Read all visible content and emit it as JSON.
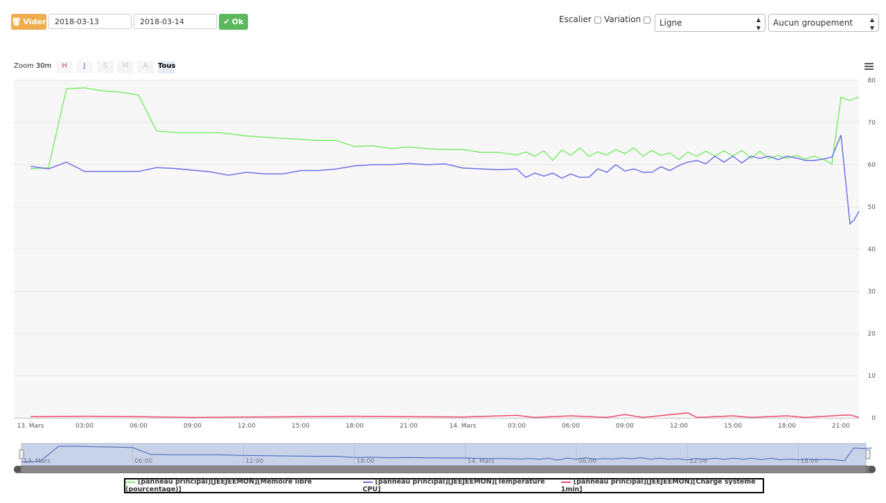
{
  "toolbar": {
    "clear_label": "Vider",
    "clear_icon": "trash-icon",
    "start_date": "2018-03-13",
    "end_date": "2018-03-14",
    "ok_label": "Ok",
    "ok_icon": "check-icon",
    "stairs_label": "Escalier",
    "stairs_checked": false,
    "variation_label": "Variation",
    "variation_checked": false,
    "chart_type_value": "Ligne",
    "grouping_value": "Aucun groupement"
  },
  "zoom": {
    "label": "Zoom",
    "buttons": [
      "30m",
      "H",
      "J",
      "S",
      "M",
      "A",
      "Tous"
    ],
    "active": "Tous"
  },
  "colors": {
    "orange": "#f0ad4e",
    "green_btn": "#5cb85c",
    "memory": "#7cec6a",
    "temperature": "#6f6fe8",
    "load": "#f0476a"
  },
  "chart_data": {
    "type": "line",
    "ylim": [
      0,
      80
    ],
    "yticks": [
      0,
      10,
      20,
      30,
      40,
      50,
      60,
      70,
      80
    ],
    "xrange": [
      "2018-03-13 00:00",
      "2018-03-14 22:00"
    ],
    "xtick_labels": [
      "13. Mars",
      "03:00",
      "06:00",
      "09:00",
      "12:00",
      "15:00",
      "18:00",
      "21:00",
      "14. Mars",
      "03:00",
      "06:00",
      "09:00",
      "12:00",
      "15:00",
      "18:00",
      "21:00"
    ],
    "navigator_labels": [
      "13. Mars",
      "06:00",
      "12:00",
      "18:00",
      "14. Mars",
      "06:00",
      "12:00",
      "18:00"
    ],
    "legend_placement": "bottom",
    "grid": true,
    "series": [
      {
        "name": "[panneau principal][JEEJEEMON][Mémoire libre (pourcentage)]",
        "color": "#7cec6a",
        "points": [
          [
            "2018-03-13 00:00",
            59
          ],
          [
            "2018-03-13 01:00",
            59.3
          ],
          [
            "2018-03-13 02:00",
            78
          ],
          [
            "2018-03-13 03:00",
            78.2
          ],
          [
            "2018-03-13 04:00",
            77.5
          ],
          [
            "2018-03-13 05:00",
            77.2
          ],
          [
            "2018-03-13 06:00",
            76.5
          ],
          [
            "2018-03-13 07:00",
            68
          ],
          [
            "2018-03-13 08:00",
            67.6
          ],
          [
            "2018-03-13 10:30",
            67.6
          ],
          [
            "2018-03-13 12:00",
            66.8
          ],
          [
            "2018-03-13 13:00",
            66.5
          ],
          [
            "2018-03-13 15:00",
            66
          ],
          [
            "2018-03-13 16:00",
            65.7
          ],
          [
            "2018-03-13 17:00",
            65.7
          ],
          [
            "2018-03-13 18:00",
            64.3
          ],
          [
            "2018-03-13 19:00",
            64.5
          ],
          [
            "2018-03-13 20:00",
            63.8
          ],
          [
            "2018-03-13 21:00",
            64.2
          ],
          [
            "2018-03-13 22:00",
            63.8
          ],
          [
            "2018-03-13 23:00",
            63.6
          ],
          [
            "2018-03-14 00:00",
            63.6
          ],
          [
            "2018-03-14 01:00",
            62.9
          ],
          [
            "2018-03-14 02:00",
            62.9
          ],
          [
            "2018-03-14 03:00",
            62.3
          ],
          [
            "2018-03-14 03:30",
            63
          ],
          [
            "2018-03-14 04:00",
            62
          ],
          [
            "2018-03-14 04:30",
            63.3
          ],
          [
            "2018-03-14 05:00",
            61
          ],
          [
            "2018-03-14 05:30",
            63.5
          ],
          [
            "2018-03-14 06:00",
            62.2
          ],
          [
            "2018-03-14 06:30",
            64
          ],
          [
            "2018-03-14 07:00",
            62
          ],
          [
            "2018-03-14 07:30",
            63
          ],
          [
            "2018-03-14 08:00",
            62.3
          ],
          [
            "2018-03-14 08:30",
            63.6
          ],
          [
            "2018-03-14 09:00",
            62.6
          ],
          [
            "2018-03-14 09:30",
            64
          ],
          [
            "2018-03-14 10:00",
            62
          ],
          [
            "2018-03-14 10:30",
            63.4
          ],
          [
            "2018-03-14 11:00",
            62.2
          ],
          [
            "2018-03-14 11:30",
            62.8
          ],
          [
            "2018-03-14 12:00",
            61.2
          ],
          [
            "2018-03-14 12:30",
            63
          ],
          [
            "2018-03-14 13:00",
            62
          ],
          [
            "2018-03-14 13:30",
            63.2
          ],
          [
            "2018-03-14 14:00",
            62
          ],
          [
            "2018-03-14 14:30",
            63.3
          ],
          [
            "2018-03-14 15:00",
            62
          ],
          [
            "2018-03-14 15:30",
            63.4
          ],
          [
            "2018-03-14 16:00",
            61.5
          ],
          [
            "2018-03-14 16:30",
            63.2
          ],
          [
            "2018-03-14 17:00",
            61.5
          ],
          [
            "2018-03-14 17:30",
            62.2
          ],
          [
            "2018-03-14 18:00",
            61.5
          ],
          [
            "2018-03-14 18:30",
            62.2
          ],
          [
            "2018-03-14 19:00",
            61.3
          ],
          [
            "2018-03-14 19:30",
            62
          ],
          [
            "2018-03-14 20:00",
            61.3
          ],
          [
            "2018-03-14 20:30",
            60.2
          ],
          [
            "2018-03-14 21:00",
            76
          ],
          [
            "2018-03-14 21:30",
            75.2
          ],
          [
            "2018-03-14 22:00",
            76
          ]
        ]
      },
      {
        "name": "[panneau principal][JEEJEEMON][Température CPU]",
        "color": "#6f6fe8",
        "points": [
          [
            "2018-03-13 00:00",
            59.6
          ],
          [
            "2018-03-13 01:00",
            59
          ],
          [
            "2018-03-13 02:00",
            60.6
          ],
          [
            "2018-03-13 03:00",
            58.4
          ],
          [
            "2018-03-13 06:00",
            58.4
          ],
          [
            "2018-03-13 07:00",
            59.3
          ],
          [
            "2018-03-13 08:00",
            59.1
          ],
          [
            "2018-03-13 10:00",
            58.3
          ],
          [
            "2018-03-13 11:00",
            57.5
          ],
          [
            "2018-03-13 12:00",
            58.2
          ],
          [
            "2018-03-13 13:00",
            57.8
          ],
          [
            "2018-03-13 14:00",
            57.8
          ],
          [
            "2018-03-13 15:00",
            58.6
          ],
          [
            "2018-03-13 16:00",
            58.6
          ],
          [
            "2018-03-13 17:00",
            59
          ],
          [
            "2018-03-13 18:00",
            59.7
          ],
          [
            "2018-03-13 19:00",
            60
          ],
          [
            "2018-03-13 20:00",
            60
          ],
          [
            "2018-03-13 21:00",
            60.3
          ],
          [
            "2018-03-13 22:00",
            60
          ],
          [
            "2018-03-13 23:00",
            60.2
          ],
          [
            "2018-03-14 00:00",
            59.2
          ],
          [
            "2018-03-14 02:00",
            58.8
          ],
          [
            "2018-03-14 03:00",
            59
          ],
          [
            "2018-03-14 03:30",
            57
          ],
          [
            "2018-03-14 04:00",
            58
          ],
          [
            "2018-03-14 04:30",
            57.3
          ],
          [
            "2018-03-14 05:00",
            58
          ],
          [
            "2018-03-14 05:30",
            56.8
          ],
          [
            "2018-03-14 06:00",
            57.8
          ],
          [
            "2018-03-14 06:30",
            57
          ],
          [
            "2018-03-14 07:00",
            57
          ],
          [
            "2018-03-14 07:30",
            59
          ],
          [
            "2018-03-14 08:00",
            58.2
          ],
          [
            "2018-03-14 08:30",
            60
          ],
          [
            "2018-03-14 09:00",
            58.5
          ],
          [
            "2018-03-14 09:30",
            59
          ],
          [
            "2018-03-14 10:00",
            58.2
          ],
          [
            "2018-03-14 10:30",
            58.2
          ],
          [
            "2018-03-14 11:00",
            59.5
          ],
          [
            "2018-03-14 11:30",
            58.6
          ],
          [
            "2018-03-14 12:00",
            59.8
          ],
          [
            "2018-03-14 12:30",
            60.6
          ],
          [
            "2018-03-14 13:00",
            61
          ],
          [
            "2018-03-14 13:30",
            60.2
          ],
          [
            "2018-03-14 14:00",
            62
          ],
          [
            "2018-03-14 14:30",
            60.6
          ],
          [
            "2018-03-14 15:00",
            62
          ],
          [
            "2018-03-14 15:30",
            60.4
          ],
          [
            "2018-03-14 16:00",
            62
          ],
          [
            "2018-03-14 16:30",
            61.5
          ],
          [
            "2018-03-14 17:00",
            62
          ],
          [
            "2018-03-14 17:30",
            61.2
          ],
          [
            "2018-03-14 18:00",
            62
          ],
          [
            "2018-03-14 18:30",
            61.6
          ],
          [
            "2018-03-14 19:00",
            61
          ],
          [
            "2018-03-14 19:30",
            61
          ],
          [
            "2018-03-14 20:00",
            61.3
          ],
          [
            "2018-03-14 20:30",
            61.8
          ],
          [
            "2018-03-14 21:00",
            67
          ],
          [
            "2018-03-14 21:30",
            46
          ],
          [
            "2018-03-14 21:45",
            47
          ],
          [
            "2018-03-14 22:00",
            49
          ]
        ]
      },
      {
        "name": "[panneau principal][JEEJEEMON][Charge système 1min]",
        "color": "#f0476a",
        "points": [
          [
            "2018-03-13 00:00",
            0.3
          ],
          [
            "2018-03-13 03:00",
            0.4
          ],
          [
            "2018-03-13 06:00",
            0.3
          ],
          [
            "2018-03-13 09:00",
            0.1
          ],
          [
            "2018-03-13 12:00",
            0.2
          ],
          [
            "2018-03-13 15:00",
            0.3
          ],
          [
            "2018-03-13 18:00",
            0.4
          ],
          [
            "2018-03-13 21:00",
            0.3
          ],
          [
            "2018-03-14 00:00",
            0.2
          ],
          [
            "2018-03-14 03:00",
            0.6
          ],
          [
            "2018-03-14 04:00",
            0.1
          ],
          [
            "2018-03-14 06:00",
            0.5
          ],
          [
            "2018-03-14 08:00",
            0.1
          ],
          [
            "2018-03-14 09:00",
            0.8
          ],
          [
            "2018-03-14 10:00",
            0.1
          ],
          [
            "2018-03-14 12:30",
            1.2
          ],
          [
            "2018-03-14 13:00",
            0.1
          ],
          [
            "2018-03-14 15:00",
            0.5
          ],
          [
            "2018-03-14 16:00",
            0.1
          ],
          [
            "2018-03-14 18:00",
            0.5
          ],
          [
            "2018-03-14 19:00",
            0.1
          ],
          [
            "2018-03-14 21:00",
            0.6
          ],
          [
            "2018-03-14 21:30",
            0.7
          ],
          [
            "2018-03-14 22:00",
            0.1
          ]
        ]
      }
    ]
  }
}
